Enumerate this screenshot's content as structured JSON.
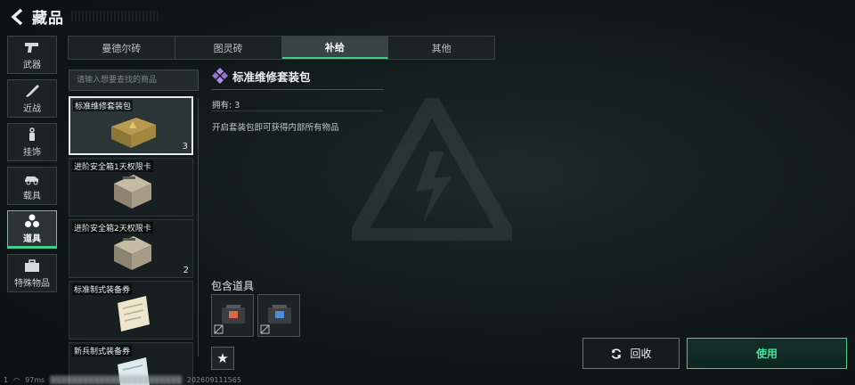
{
  "header": {
    "title": "藏品"
  },
  "categories": [
    {
      "label": "武器",
      "icon": "pistol-icon"
    },
    {
      "label": "近战",
      "icon": "knife-icon"
    },
    {
      "label": "挂饰",
      "icon": "charm-icon"
    },
    {
      "label": "载具",
      "icon": "vehicle-icon"
    },
    {
      "label": "道具",
      "icon": "items-icon",
      "active": true
    },
    {
      "label": "特殊物品",
      "icon": "briefcase-icon"
    }
  ],
  "tabs": [
    {
      "label": "曼德尔砖"
    },
    {
      "label": "图灵砖"
    },
    {
      "label": "补给",
      "active": true
    },
    {
      "label": "其他"
    }
  ],
  "search": {
    "placeholder": "请输入想要查找的商品"
  },
  "items": [
    {
      "name": "标准维修套装包",
      "qty": "3",
      "selected": true,
      "icon": "repair-kit-icon"
    },
    {
      "name": "进阶安全箱1天权限卡",
      "qty": "",
      "icon": "safe-box-icon"
    },
    {
      "name": "进阶安全箱2天权限卡",
      "qty": "2",
      "icon": "safe-box-icon"
    },
    {
      "name": "标准制式装备券",
      "qty": "",
      "icon": "voucher-icon"
    },
    {
      "name": "新兵制式装备券",
      "qty": "",
      "icon": "voucher-icon"
    }
  ],
  "detail": {
    "title": "标准维修套装包",
    "owned": "拥有: 3",
    "description": "开启套装包即可获得内部所有物品",
    "contains_title": "包含道具",
    "contents": [
      {
        "icon": "armor-repair-kit-icon",
        "accent": "#d9694a"
      },
      {
        "icon": "helmet-repair-kit-icon",
        "accent": "#4a8fd9"
      }
    ]
  },
  "buttons": {
    "recycle": "回收",
    "use": "使用"
  },
  "status": {
    "signal": "1",
    "ping": "97ms",
    "id": "202609111565"
  },
  "colors": {
    "accent": "#3fd08a",
    "background": "#121a1c"
  }
}
